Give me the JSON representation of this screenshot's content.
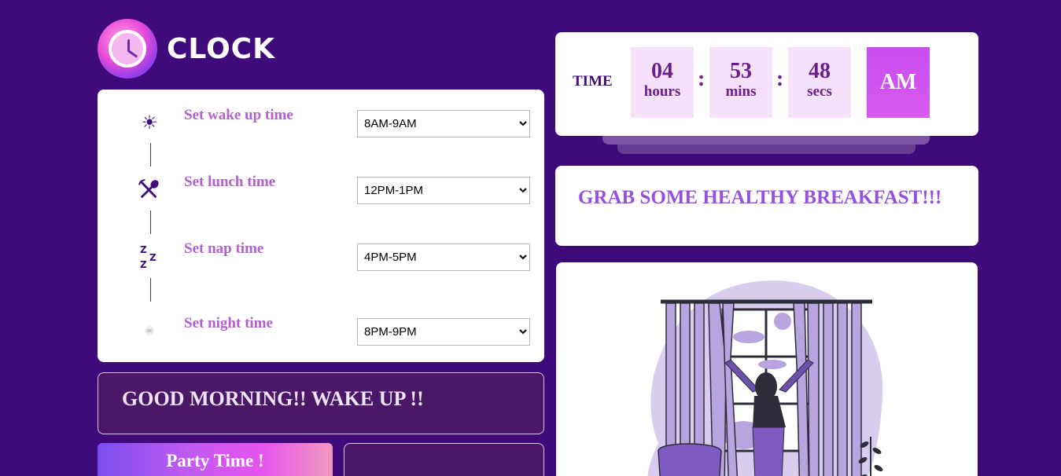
{
  "logo": {
    "title": "CLOCK",
    "icon": "clock-icon"
  },
  "schedule": [
    {
      "label": "Set wake up time",
      "icon": "sun-icon",
      "value": "8AM-9AM"
    },
    {
      "label": "Set lunch time",
      "icon": "fork-spoon-icon",
      "value": "12PM-1PM"
    },
    {
      "label": "Set nap time",
      "icon": "zzz-icon",
      "value": "4PM-5PM"
    },
    {
      "label": "Set night time",
      "icon": "moon-icon",
      "value": "8PM-9PM"
    }
  ],
  "wake_message": "GOOD MORNING!! WAKE UP !!",
  "party_button": "Party Time !",
  "time": {
    "label": "TIME",
    "hours": "04",
    "hours_unit": "hours",
    "mins": "53",
    "mins_unit": "mins",
    "secs": "48",
    "secs_unit": "secs",
    "separator": ":",
    "ampm": "AM"
  },
  "message": "GRAB SOME HEALTHY BREAKFAST!!!",
  "illustration": "woman-opening-curtains-illustration",
  "colors": {
    "background": "#3f0a7a",
    "accent": "#b25fd0",
    "message": "#9650e0"
  }
}
